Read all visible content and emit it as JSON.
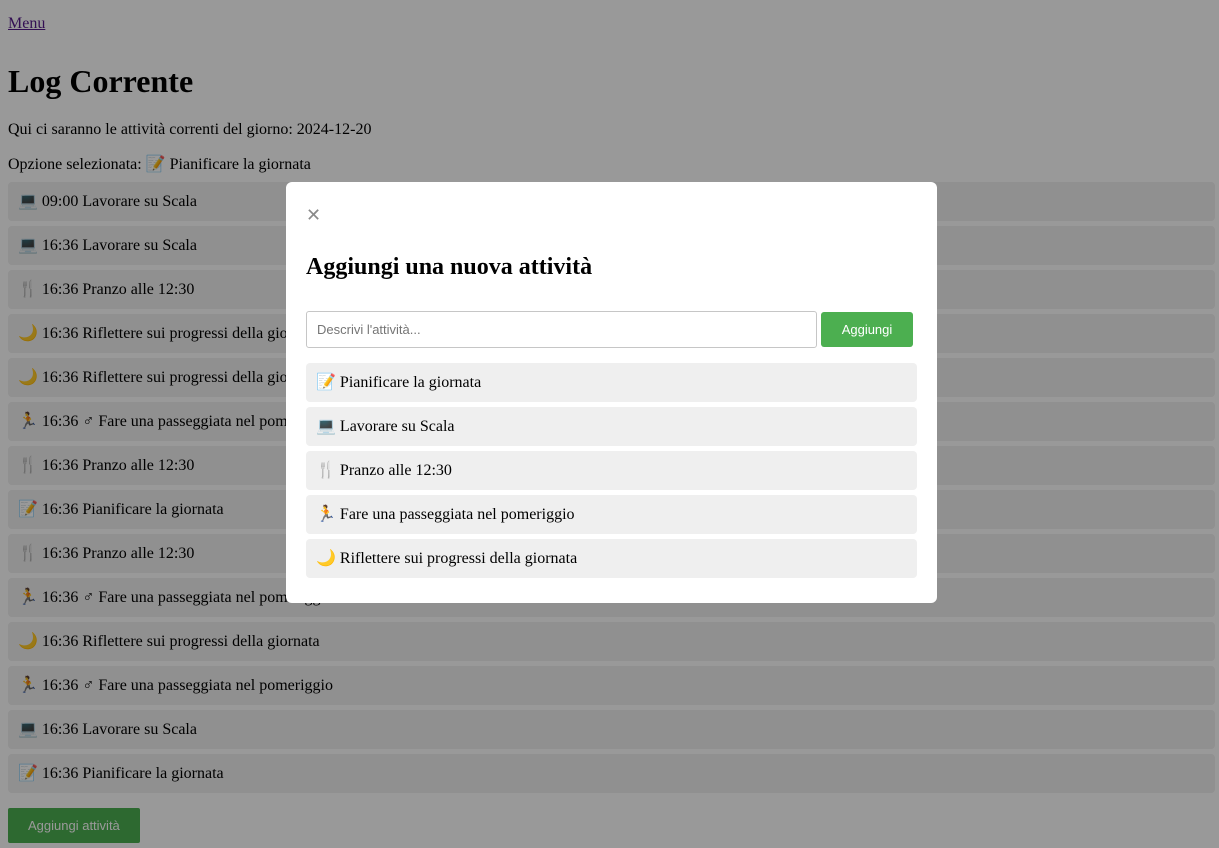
{
  "nav": {
    "menu_label": "Menu"
  },
  "page": {
    "title": "Log Corrente",
    "subtitle": "Qui ci saranno le attività correnti del giorno: 2024-12-20",
    "selected_option": "Opzione selezionata: 📝 Pianificare la giornata"
  },
  "log": [
    {
      "text": "💻 09:00 Lavorare su Scala"
    },
    {
      "text": "💻 16:36 Lavorare su Scala"
    },
    {
      "text": "🍴 16:36 Pranzo alle 12:30"
    },
    {
      "text": "🌙 16:36 Riflettere sui progressi della giornata"
    },
    {
      "text": "🌙 16:36 Riflettere sui progressi della giornata"
    },
    {
      "text": "🏃 16:36 ♂ Fare una passeggiata nel pomeriggio"
    },
    {
      "text": "🍴 16:36 Pranzo alle 12:30"
    },
    {
      "text": "📝 16:36 Pianificare la giornata"
    },
    {
      "text": "🍴 16:36 Pranzo alle 12:30"
    },
    {
      "text": "🏃 16:36 ♂ Fare una passeggiata nel pomeriggio"
    },
    {
      "text": "🌙 16:36 Riflettere sui progressi della giornata"
    },
    {
      "text": "🏃 16:36 ♂ Fare una passeggiata nel pomeriggio"
    },
    {
      "text": "💻 16:36 Lavorare su Scala"
    },
    {
      "text": "📝 16:36 Pianificare la giornata"
    }
  ],
  "add_activity_button": "Aggiungi attività",
  "modal": {
    "close_glyph": "✕",
    "title": "Aggiungi una nuova attività",
    "input_placeholder": "Descrivi l'attività...",
    "input_value": "",
    "add_button": "Aggiungi",
    "options": [
      {
        "text": "📝 Pianificare la giornata"
      },
      {
        "text": "💻 Lavorare su Scala"
      },
      {
        "text": "🍴 Pranzo alle 12:30"
      },
      {
        "text": "🏃 Fare una passeggiata nel pomeriggio"
      },
      {
        "text": "🌙 Riflettere sui progressi della giornata"
      }
    ]
  },
  "colors": {
    "accent_green": "#4caf50",
    "overlay": "rgba(0,0,0,0.4)",
    "item_background": "#f0f0f0"
  }
}
